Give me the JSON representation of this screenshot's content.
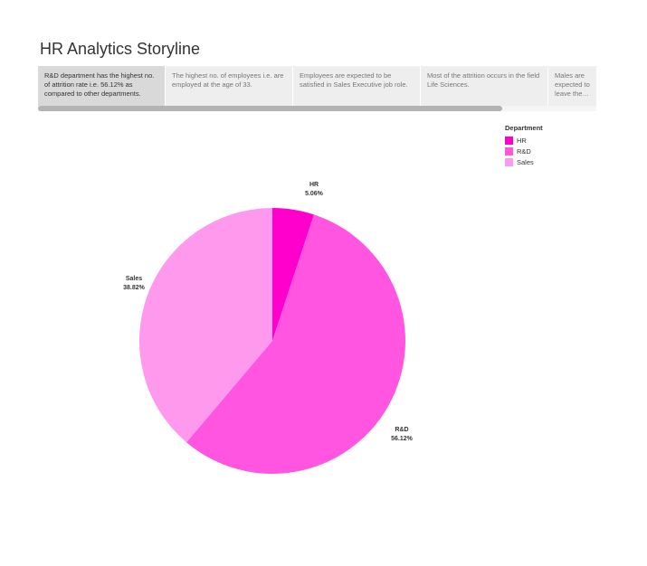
{
  "story": {
    "title": "HR Analytics Storyline",
    "points": [
      {
        "text": "R&D department has the highest no. of attrition rate i.e. 56.12% as compared to other departments.",
        "active": true
      },
      {
        "text": "The highest no. of employees i.e. are employed at the age of 33.",
        "active": false
      },
      {
        "text": "Employees are expected to be satisfied in Sales Executive job role.",
        "active": false
      },
      {
        "text": "Most of the attrition occurs in the field Life Sciences.",
        "active": false
      },
      {
        "text": "Males are expected to leave the or...",
        "active": false
      }
    ]
  },
  "legend": {
    "title": "Department",
    "items": [
      {
        "label": "HR",
        "color": "#ff00cc"
      },
      {
        "label": "R&D",
        "color": "#ff55e0"
      },
      {
        "label": "Sales",
        "color": "#ff99ee"
      }
    ]
  },
  "chart_data": {
    "type": "pie",
    "title": "",
    "categories": [
      "HR",
      "R&D",
      "Sales"
    ],
    "values": [
      5.06,
      56.12,
      38.82
    ],
    "labels": [
      "5.06%",
      "56.12%",
      "38.82%"
    ],
    "colors": [
      "#ff00cc",
      "#ff55e0",
      "#ff99ee"
    ],
    "legend_title": "Department",
    "legend_position": "top-right"
  }
}
